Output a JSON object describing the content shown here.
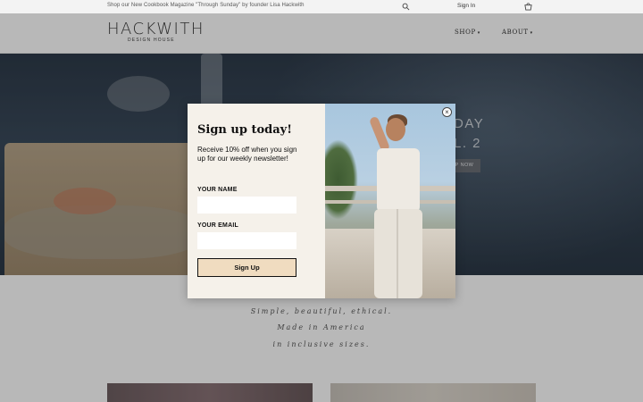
{
  "announcement": "Shop our New Cookbook Magazine \"Through Sunday\" by founder Lisa Hackwith",
  "topbar": {
    "signin": "Sign In"
  },
  "logo": {
    "word": "HACKWITH",
    "sub": "DESIGN HOUSE"
  },
  "nav": [
    {
      "label": "SHOP"
    },
    {
      "label": "ABOUT"
    }
  ],
  "hero": {
    "line1": "DAY",
    "line2": "L. 2",
    "button": "OP NOW"
  },
  "tagline": [
    "Simple, beautiful, ethical.",
    "Made in America",
    "in inclusive sizes."
  ],
  "popup": {
    "title": "Sign up today!",
    "description": "Receive 10% off when you sign up for our weekly newsletter!",
    "name_label": "YOUR NAME",
    "email_label": "YOUR EMAIL",
    "submit": "Sign Up",
    "close": "×"
  },
  "icons": {
    "search": "search-icon",
    "cart": "cart-icon",
    "close": "close-icon",
    "chevron": "chevron-down-icon"
  },
  "colors": {
    "popup_bg": "#f5f1ea",
    "button_bg": "#f0dcc0"
  }
}
